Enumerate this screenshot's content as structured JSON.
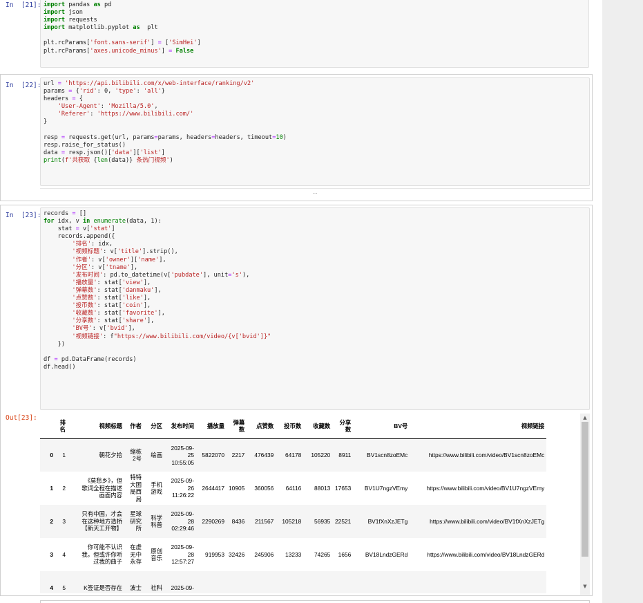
{
  "cells": [
    {
      "prompt": "In  [21]:",
      "lines": [
        [
          [
            "kw",
            "import"
          ],
          [
            "t",
            " pandas "
          ],
          [
            "kw",
            "as"
          ],
          [
            "t",
            " pd"
          ]
        ],
        [
          [
            "kw",
            "import"
          ],
          [
            "t",
            " json"
          ]
        ],
        [
          [
            "kw",
            "import"
          ],
          [
            "t",
            " requests"
          ]
        ],
        [
          [
            "kw",
            "import"
          ],
          [
            "t",
            " matplotlib.pyplot "
          ],
          [
            "kw",
            "as"
          ],
          [
            "t",
            "  plt"
          ]
        ],
        [
          [
            "t",
            ""
          ]
        ],
        [
          [
            "t",
            "plt.rcParams["
          ],
          [
            "st",
            "'font.sans-serif'"
          ],
          [
            "t",
            "] "
          ],
          [
            "op",
            "="
          ],
          [
            "t",
            " ["
          ],
          [
            "st",
            "'SimHei'"
          ],
          [
            "t",
            "]"
          ]
        ],
        [
          [
            "t",
            "plt.rcParams["
          ],
          [
            "st",
            "'axes.unicode_minus'"
          ],
          [
            "t",
            "] "
          ],
          [
            "op",
            "="
          ],
          [
            "t",
            " "
          ],
          [
            "kw",
            "False"
          ]
        ]
      ]
    },
    {
      "prompt": "In  [22]:",
      "lines": [
        [
          [
            "t",
            "url "
          ],
          [
            "op",
            "="
          ],
          [
            "t",
            " "
          ],
          [
            "st",
            "'https://api.bilibili.com/x/web-interface/ranking/v2'"
          ]
        ],
        [
          [
            "t",
            "params "
          ],
          [
            "op",
            "="
          ],
          [
            "t",
            " {"
          ],
          [
            "st",
            "'rid'"
          ],
          [
            "t",
            ": 0, "
          ],
          [
            "st",
            "'type'"
          ],
          [
            "t",
            ": "
          ],
          [
            "st",
            "'all'"
          ],
          [
            "t",
            "}"
          ]
        ],
        [
          [
            "t",
            "headers "
          ],
          [
            "op",
            "="
          ],
          [
            "t",
            " {"
          ]
        ],
        [
          [
            "t",
            "    "
          ],
          [
            "st",
            "'User-Agent'"
          ],
          [
            "t",
            ": "
          ],
          [
            "st",
            "'Mozilla/5.0'"
          ],
          [
            "t",
            ","
          ]
        ],
        [
          [
            "t",
            "    "
          ],
          [
            "st",
            "'Referer'"
          ],
          [
            "t",
            ": "
          ],
          [
            "st",
            "'https://www.bilibili.com/'"
          ]
        ],
        [
          [
            "t",
            "}"
          ]
        ],
        [
          [
            "t",
            ""
          ]
        ],
        [
          [
            "t",
            "resp "
          ],
          [
            "op",
            "="
          ],
          [
            "t",
            " requests.get(url, params"
          ],
          [
            "op",
            "="
          ],
          [
            "t",
            "params, headers"
          ],
          [
            "op",
            "="
          ],
          [
            "t",
            "headers, timeout"
          ],
          [
            "op",
            "="
          ],
          [
            "num",
            "10"
          ],
          [
            "t",
            ")"
          ]
        ],
        [
          [
            "t",
            "resp.raise_for_status()"
          ]
        ],
        [
          [
            "t",
            "data "
          ],
          [
            "op",
            "="
          ],
          [
            "t",
            " resp.json()["
          ],
          [
            "st",
            "'data'"
          ],
          [
            "t",
            "]["
          ],
          [
            "st",
            "'list'"
          ],
          [
            "t",
            "]"
          ]
        ],
        [
          [
            "bi",
            "print"
          ],
          [
            "t",
            "("
          ],
          [
            "st",
            "f'共获取 "
          ],
          [
            "t",
            "{"
          ],
          [
            "bi",
            "len"
          ],
          [
            "t",
            "(data)}"
          ],
          [
            "st",
            " 条热门视频'"
          ],
          [
            "t",
            ")"
          ]
        ]
      ],
      "collapsed_marker": "..."
    },
    {
      "prompt": "In  [23]:",
      "lines": [
        [
          [
            "t",
            "records "
          ],
          [
            "op",
            "="
          ],
          [
            "t",
            " []"
          ]
        ],
        [
          [
            "kw",
            "for"
          ],
          [
            "t",
            " idx, v "
          ],
          [
            "kw",
            "in"
          ],
          [
            "t",
            " "
          ],
          [
            "bi",
            "enumerate"
          ],
          [
            "t",
            "(data, 1):"
          ]
        ],
        [
          [
            "t",
            "    stat "
          ],
          [
            "op",
            "="
          ],
          [
            "t",
            " v["
          ],
          [
            "st",
            "'stat'"
          ],
          [
            "t",
            "]"
          ]
        ],
        [
          [
            "t",
            "    records.append({"
          ]
        ],
        [
          [
            "t",
            "        "
          ],
          [
            "st",
            "'排名'"
          ],
          [
            "t",
            ": idx,"
          ]
        ],
        [
          [
            "t",
            "        "
          ],
          [
            "st",
            "'视频标题'"
          ],
          [
            "t",
            ": v["
          ],
          [
            "st",
            "'title'"
          ],
          [
            "t",
            "].strip(),"
          ]
        ],
        [
          [
            "t",
            "        "
          ],
          [
            "st",
            "'作者'"
          ],
          [
            "t",
            ": v["
          ],
          [
            "st",
            "'owner'"
          ],
          [
            "t",
            "]["
          ],
          [
            "st",
            "'name'"
          ],
          [
            "t",
            "],"
          ]
        ],
        [
          [
            "t",
            "        "
          ],
          [
            "st",
            "'分区'"
          ],
          [
            "t",
            ": v["
          ],
          [
            "st",
            "'tname'"
          ],
          [
            "t",
            "],"
          ]
        ],
        [
          [
            "t",
            "        "
          ],
          [
            "st",
            "'发布时间'"
          ],
          [
            "t",
            ": pd.to_datetime(v["
          ],
          [
            "st",
            "'pubdate'"
          ],
          [
            "t",
            "], unit"
          ],
          [
            "op",
            "="
          ],
          [
            "st",
            "'s'"
          ],
          [
            "t",
            "),"
          ]
        ],
        [
          [
            "t",
            "        "
          ],
          [
            "st",
            "'播放量'"
          ],
          [
            "t",
            ": stat["
          ],
          [
            "st",
            "'view'"
          ],
          [
            "t",
            "],"
          ]
        ],
        [
          [
            "t",
            "        "
          ],
          [
            "st",
            "'弹幕数'"
          ],
          [
            "t",
            ": stat["
          ],
          [
            "st",
            "'danmaku'"
          ],
          [
            "t",
            "],"
          ]
        ],
        [
          [
            "t",
            "        "
          ],
          [
            "st",
            "'点赞数'"
          ],
          [
            "t",
            ": stat["
          ],
          [
            "st",
            "'like'"
          ],
          [
            "t",
            "],"
          ]
        ],
        [
          [
            "t",
            "        "
          ],
          [
            "st",
            "'投币数'"
          ],
          [
            "t",
            ": stat["
          ],
          [
            "st",
            "'coin'"
          ],
          [
            "t",
            "],"
          ]
        ],
        [
          [
            "t",
            "        "
          ],
          [
            "st",
            "'收藏数'"
          ],
          [
            "t",
            ": stat["
          ],
          [
            "st",
            "'favorite'"
          ],
          [
            "t",
            "],"
          ]
        ],
        [
          [
            "t",
            "        "
          ],
          [
            "st",
            "'分享数'"
          ],
          [
            "t",
            ": stat["
          ],
          [
            "st",
            "'share'"
          ],
          [
            "t",
            "],"
          ]
        ],
        [
          [
            "t",
            "        "
          ],
          [
            "st",
            "'BV号'"
          ],
          [
            "t",
            ": v["
          ],
          [
            "st",
            "'bvid'"
          ],
          [
            "t",
            "],"
          ]
        ],
        [
          [
            "t",
            "        "
          ],
          [
            "st",
            "'视频链接'"
          ],
          [
            "t",
            ": f"
          ],
          [
            "st",
            "\"https://www.bilibili.com/video/{v['bvid']}\""
          ]
        ],
        [
          [
            "t",
            "    })"
          ]
        ],
        [
          [
            "t",
            ""
          ]
        ],
        [
          [
            "t",
            "df "
          ],
          [
            "op",
            "="
          ],
          [
            "t",
            " pd.DataFrame(records)"
          ]
        ],
        [
          [
            "t",
            "df.head()"
          ]
        ]
      ]
    }
  ],
  "output": {
    "prompt": "Out[23]:",
    "columns": [
      "",
      "排\n名",
      "视频标题",
      "作者",
      "分区",
      "发布时间",
      "播放量",
      "弹幕\n数",
      "点赞数",
      "投币数",
      "收藏数",
      "分享\n数",
      "BV号",
      "视频链接"
    ],
    "rows": [
      [
        "0",
        "1",
        "朝花夕拾",
        "缩栋\n2号",
        "绘画",
        "2025-09-\n25\n10:55:05",
        "5822070",
        "2217",
        "476439",
        "64178",
        "105220",
        "8911",
        "BV1scn8zoEMc",
        "https://www.bilibili.com/video/BV1scn8zoEMc"
      ],
      [
        "1",
        "2",
        "《莫愁乡》，但\n歌词全程在描述\n画面内容",
        "特特\n大困\n局西\n局",
        "手机\n游戏",
        "2025-09-\n26\n11:26:22",
        "2644417",
        "10905",
        "360056",
        "64116",
        "88013",
        "17653",
        "BV1U7ngzVEmy",
        "https://www.bilibili.com/video/BV1U7ngzVEmy"
      ],
      [
        "2",
        "3",
        "只有中国，才会\n在这种地方造桥\n【新天工开物】",
        "星球\n研究\n所",
        "科学\n科普",
        "2025-09-\n28\n02:29:46",
        "2290269",
        "8436",
        "211567",
        "105218",
        "56935",
        "22521",
        "BV1fXnXzJETg",
        "https://www.bilibili.com/video/BV1fXnXzJETg"
      ],
      [
        "3",
        "4",
        "你可能不认识\n我，但或许你听\n过我的曲子",
        "在虚\n无中\n永存",
        "原创\n音乐",
        "2025-09-\n28\n12:57:27",
        "919953",
        "32426",
        "245906",
        "13233",
        "74265",
        "1656",
        "BV18LndzGERd",
        "https://www.bilibili.com/video/BV18LndzGERd"
      ],
      [
        "4",
        "5",
        "K签证是否存在",
        "波士",
        "社科",
        "2025-09-",
        "",
        "",
        "",
        "",
        "",
        "",
        "",
        ""
      ]
    ]
  },
  "scrollbar": {
    "up_icon": "▲",
    "down_icon": "▼"
  }
}
